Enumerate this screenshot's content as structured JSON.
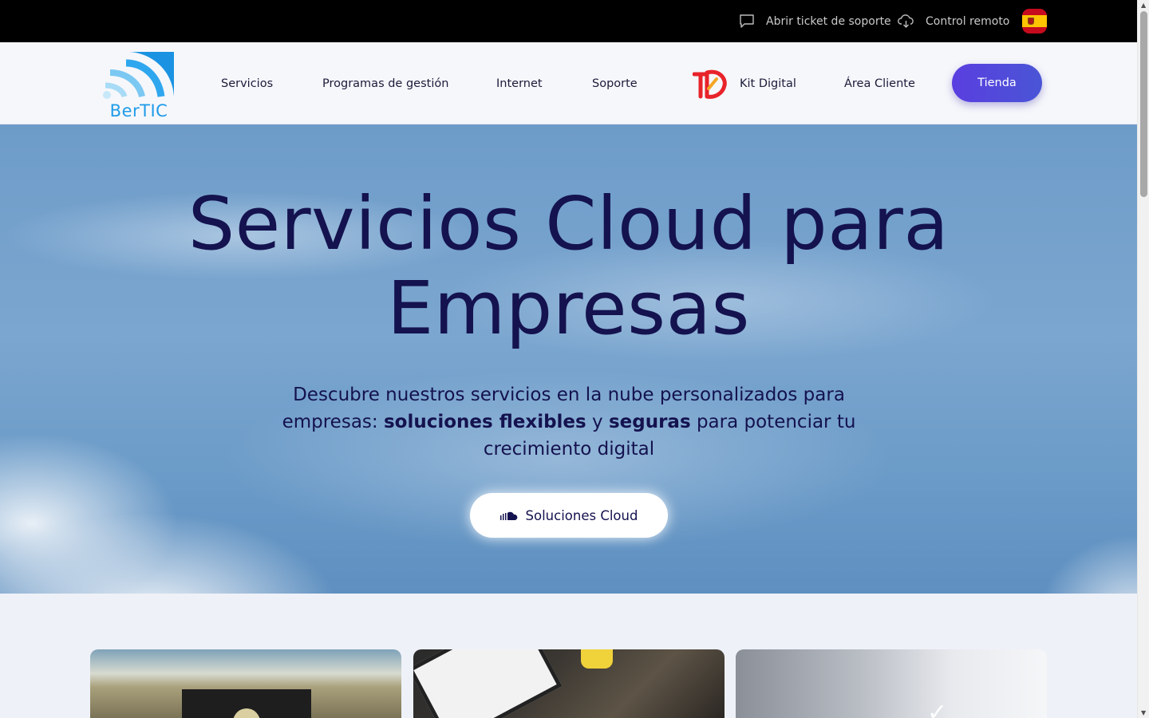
{
  "topbar": {
    "ticket_label": "Abrir ticket de soporte",
    "ticket_icon": "chat-bubble-icon",
    "remote_label": "Control remoto",
    "remote_icon": "cloud-download-icon",
    "language_flag": "spain-flag-icon"
  },
  "header": {
    "logo_text": "BerTIC",
    "nav": {
      "servicios": "Servicios",
      "programas": "Programas de gestión",
      "internet": "Internet",
      "soporte": "Soporte",
      "kit_digital": "Kit Digital",
      "area_cliente": "Área Cliente"
    },
    "shop_button": "Tienda"
  },
  "hero": {
    "title_line1": "Servicios Cloud para",
    "title_line2": "Empresas",
    "subtitle_part1": "Descubre nuestros servicios en la nube personalizados para empresas: ",
    "subtitle_bold1": "soluciones flexibles",
    "subtitle_part2": " y ",
    "subtitle_bold2": "seguras",
    "subtitle_part3": " para potenciar tu crecimiento digital",
    "cta_label": "Soluciones Cloud",
    "cta_icon": "soundcloud-cloud-icon"
  },
  "colors": {
    "topbar_bg": "#000000",
    "primary_text": "#14124f",
    "shop_gradient_start": "#5a3ee0",
    "shop_gradient_end": "#4a55d6",
    "logo_blue": "#1f9be8"
  }
}
